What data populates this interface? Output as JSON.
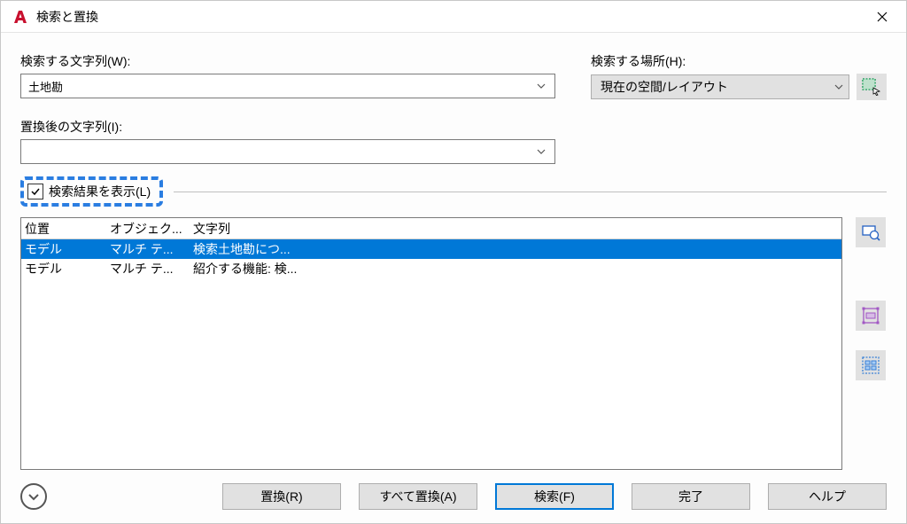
{
  "titlebar": {
    "title": "検索と置換"
  },
  "fields": {
    "find_label": "検索する文字列(W):",
    "find_value": "土地勘",
    "replace_label": "置換後の文字列(I):",
    "replace_value": "",
    "location_label": "検索する場所(H):",
    "location_value": "現在の空間/レイアウト"
  },
  "show_results": {
    "label": "検索結果を表示(L)",
    "checked": true
  },
  "results": {
    "headers": {
      "location": "位置",
      "object": "オブジェク...",
      "string": "文字列"
    },
    "rows": [
      {
        "location": "モデル",
        "object": "マルチ テ...",
        "string": "検索土地勘につ...",
        "selected": true
      },
      {
        "location": "モデル",
        "object": "マルチ テ...",
        "string": "紹介する機能: 検...",
        "selected": false
      }
    ]
  },
  "buttons": {
    "replace": "置換(R)",
    "replace_all": "すべて置換(A)",
    "find": "検索(F)",
    "done": "完了",
    "help": "ヘルプ"
  },
  "colors": {
    "highlight": "#2a7de1",
    "selection": "#0078d7"
  }
}
